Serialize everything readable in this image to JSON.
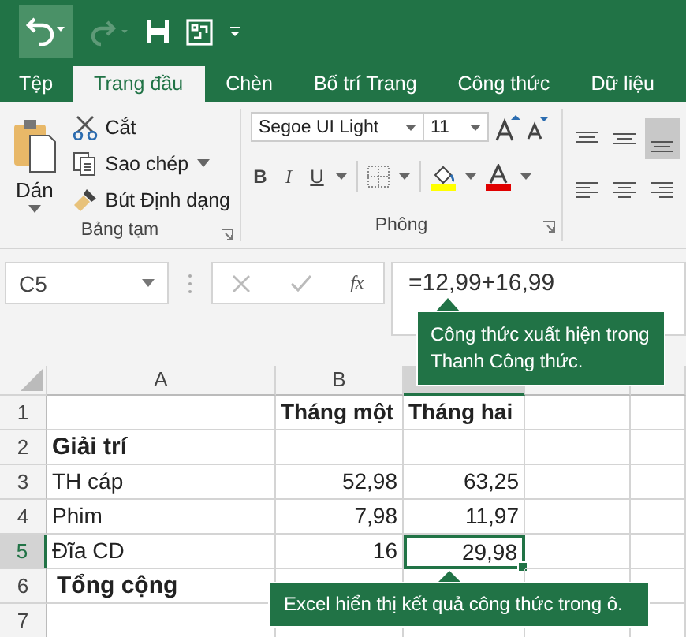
{
  "tabs": [
    {
      "label": "Tệp",
      "selected": false
    },
    {
      "label": "Trang đầu",
      "selected": true
    },
    {
      "label": "Chèn",
      "selected": false
    },
    {
      "label": "Bố trí Trang",
      "selected": false
    },
    {
      "label": "Công thức",
      "selected": false
    },
    {
      "label": "Dữ liệu",
      "selected": false
    }
  ],
  "clipboard": {
    "paste": "Dán",
    "cut": "Cắt",
    "copy": "Sao chép",
    "format_painter": "Bút Định dạng",
    "group_label": "Bảng tạm"
  },
  "font": {
    "font_name": "Segoe UI Light",
    "font_size": "11",
    "bold": "B",
    "italic": "I",
    "underline": "U",
    "group_label": "Phông"
  },
  "formula_bar": {
    "name_box": "C5",
    "function_symbol": "fx",
    "formula": "=12,99+16,99"
  },
  "columns": [
    {
      "label": "A",
      "selected": false
    },
    {
      "label": "B",
      "selected": false
    },
    {
      "selected": true
    }
  ],
  "rows": [
    {
      "number": "1",
      "kind": "heading",
      "selected": false,
      "b": "Tháng một",
      "c": "Tháng hai"
    },
    {
      "number": "2",
      "kind": "section",
      "selected": false,
      "a": "Giải trí"
    },
    {
      "number": "3",
      "kind": "data",
      "selected": false,
      "a": "TH cáp",
      "b": "52,98",
      "c": "63,25"
    },
    {
      "number": "4",
      "kind": "data",
      "selected": false,
      "a": "Phim",
      "b": "7,98",
      "c": "11,97"
    },
    {
      "number": "5",
      "kind": "data",
      "selected": true,
      "a": "Đĩa CD",
      "b": "16",
      "c": "29,98"
    },
    {
      "number": "6",
      "kind": "total",
      "selected": false,
      "a": "Tổng cộng"
    },
    {
      "number": "7",
      "kind": "empty",
      "selected": false
    }
  ],
  "callouts": [
    {
      "text": "Công thức xuất hiện trong Thanh Công thức."
    },
    {
      "text": "Excel hiển thị kết quả công thức trong ô."
    }
  ]
}
